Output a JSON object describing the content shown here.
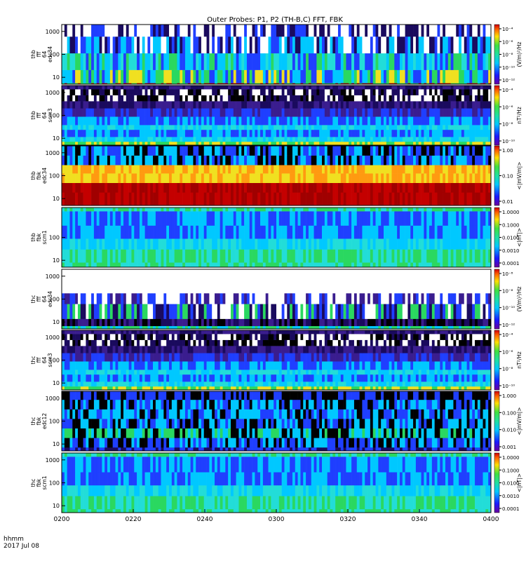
{
  "title": "Outer Probes: P1, P2 (TH-B,C) FFT, FBK",
  "time_axis": {
    "label_line1": "hhmm",
    "label_line2": "2017 Jul 08",
    "ticks": [
      "0200",
      "0220",
      "0240",
      "0300",
      "0320",
      "0340",
      "0400"
    ]
  },
  "colors": {
    "black": "#000000",
    "navy": "#1a0a5e",
    "purple": "#3a1d8f",
    "blue": "#1f3fff",
    "cyan": "#00c8ff",
    "aqua": "#22ddd8",
    "green": "#2ad860",
    "yellow": "#f0e020",
    "orange": "#ff9a10",
    "red": "#c40000",
    "darkred": "#a00000"
  },
  "chart_data": [
    {
      "type": "heatmap",
      "ylabel": [
        "thb",
        "fff",
        "64",
        "edc34"
      ],
      "yticks": [
        "10",
        "100",
        "1000"
      ],
      "colorbar_label": "(V/m)²/Hz",
      "colorbar_ticks": [
        "10⁻⁴",
        "10⁻⁶",
        "10⁻⁸",
        "10⁻¹⁰",
        "10⁻¹²"
      ],
      "bands": [
        {
          "frac": 0.02,
          "palette": [
            "red",
            "green"
          ]
        },
        {
          "frac": 0.22,
          "palette": [
            "cyan",
            "green",
            "yellow",
            "blue"
          ]
        },
        {
          "frac": 0.28,
          "palette": [
            "cyan",
            "blue",
            "green",
            "aqua"
          ]
        },
        {
          "frac": 0.28,
          "palette": [
            "blue",
            "cyan",
            "navy",
            "white"
          ]
        },
        {
          "frac": 0.2,
          "palette": [
            "white",
            "blue",
            "navy",
            "white"
          ]
        }
      ]
    },
    {
      "type": "heatmap",
      "ylabel": [
        "thb",
        "fff",
        "64",
        "scm3"
      ],
      "yticks": [
        "10",
        "100",
        "1000"
      ],
      "colorbar_label": "nT²/Hz",
      "colorbar_ticks": [
        "10⁻⁴",
        "10⁻⁶",
        "10⁻⁸",
        "10⁻¹⁰"
      ],
      "bands": [
        {
          "frac": 0.06,
          "palette": [
            "green",
            "yellow"
          ]
        },
        {
          "frac": 0.08,
          "palette": [
            "aqua",
            "cyan"
          ]
        },
        {
          "frac": 0.12,
          "palette": [
            "cyan",
            "blue"
          ]
        },
        {
          "frac": 0.08,
          "palette": [
            "aqua",
            "cyan"
          ]
        },
        {
          "frac": 0.14,
          "palette": [
            "blue",
            "cyan"
          ]
        },
        {
          "frac": 0.14,
          "palette": [
            "blue",
            "purple"
          ]
        },
        {
          "frac": 0.12,
          "palette": [
            "navy",
            "purple"
          ]
        },
        {
          "frac": 0.1,
          "palette": [
            "navy",
            "black",
            "white"
          ]
        },
        {
          "frac": 0.1,
          "palette": [
            "white",
            "black",
            "navy"
          ]
        },
        {
          "frac": 0.06,
          "palette": [
            "purple",
            "navy"
          ]
        }
      ]
    },
    {
      "type": "heatmap",
      "ylabel": [
        "thb",
        "fbk",
        "edc34"
      ],
      "yticks": [
        "10",
        "100",
        "1000"
      ],
      "colorbar_label": "<|mV/m|>",
      "colorbar_ticks": [
        "1.00",
        "0.10",
        "0.01"
      ],
      "bands": [
        {
          "frac": 0.22,
          "palette": [
            "darkred",
            "red"
          ]
        },
        {
          "frac": 0.16,
          "palette": [
            "red",
            "darkred"
          ]
        },
        {
          "frac": 0.16,
          "palette": [
            "orange",
            "yellow"
          ]
        },
        {
          "frac": 0.14,
          "palette": [
            "yellow",
            "orange"
          ]
        },
        {
          "frac": 0.16,
          "palette": [
            "cyan",
            "blue",
            "black"
          ]
        },
        {
          "frac": 0.16,
          "palette": [
            "black",
            "cyan",
            "blue"
          ]
        }
      ]
    },
    {
      "type": "heatmap",
      "ylabel": [
        "thb",
        "fbk",
        "scm1"
      ],
      "yticks": [
        "10",
        "100"
      ],
      "colorbar_label": "<|nT|>",
      "colorbar_ticks": [
        "1.0000",
        "0.1000",
        "0.0100",
        "0.0010",
        "0.0001"
      ],
      "bands": [
        {
          "frac": 0.08,
          "palette": [
            "green",
            "aqua"
          ]
        },
        {
          "frac": 0.22,
          "palette": [
            "aqua",
            "green"
          ]
        },
        {
          "frac": 0.18,
          "palette": [
            "cyan",
            "aqua"
          ]
        },
        {
          "frac": 0.22,
          "palette": [
            "blue",
            "cyan"
          ]
        },
        {
          "frac": 0.24,
          "palette": [
            "blue",
            "cyan"
          ]
        },
        {
          "frac": 0.06,
          "palette": [
            "green",
            "aqua"
          ]
        }
      ]
    },
    {
      "type": "heatmap",
      "ylabel": [
        "thc",
        "fff",
        "64",
        "edc34"
      ],
      "yticks": [
        "10",
        "100",
        "1000"
      ],
      "colorbar_label": "(V/m)²/Hz",
      "colorbar_ticks": [
        "10⁻⁸",
        "10⁻⁸",
        "10⁻¹⁰",
        "10⁻¹²"
      ],
      "bands": [
        {
          "frac": 0.05,
          "palette": [
            "green",
            "cyan"
          ]
        },
        {
          "frac": 0.12,
          "palette": [
            "navy",
            "purple",
            "black"
          ]
        },
        {
          "frac": 0.25,
          "palette": [
            "blue",
            "navy",
            "white",
            "green"
          ]
        },
        {
          "frac": 0.18,
          "palette": [
            "white",
            "blue",
            "purple",
            "white"
          ]
        },
        {
          "frac": 0.4,
          "palette": [
            "white"
          ]
        }
      ]
    },
    {
      "type": "heatmap",
      "ylabel": [
        "thc",
        "fff",
        "64",
        "scm3"
      ],
      "yticks": [
        "10",
        "100",
        "1000"
      ],
      "colorbar_label": "nT²/Hz",
      "colorbar_ticks": [
        "10⁻⁴",
        "10⁻⁶",
        "10⁻⁸",
        "10⁻¹⁰"
      ],
      "bands": [
        {
          "frac": 0.06,
          "palette": [
            "green",
            "yellow"
          ]
        },
        {
          "frac": 0.08,
          "palette": [
            "aqua",
            "cyan"
          ]
        },
        {
          "frac": 0.12,
          "palette": [
            "cyan",
            "blue"
          ]
        },
        {
          "frac": 0.08,
          "palette": [
            "aqua",
            "cyan"
          ]
        },
        {
          "frac": 0.14,
          "palette": [
            "blue",
            "cyan"
          ]
        },
        {
          "frac": 0.14,
          "palette": [
            "blue",
            "purple"
          ]
        },
        {
          "frac": 0.12,
          "palette": [
            "navy",
            "purple"
          ]
        },
        {
          "frac": 0.1,
          "palette": [
            "navy",
            "black",
            "white"
          ]
        },
        {
          "frac": 0.1,
          "palette": [
            "white",
            "black",
            "navy"
          ]
        },
        {
          "frac": 0.06,
          "palette": [
            "purple",
            "navy"
          ]
        }
      ]
    },
    {
      "type": "heatmap",
      "ylabel": [
        "thc",
        "fbk",
        "edc12"
      ],
      "yticks": [
        "10",
        "100",
        "1000"
      ],
      "colorbar_label": "<|mV/m|>",
      "colorbar_ticks": [
        "1.000",
        "0.100",
        "0.010",
        "0.001"
      ],
      "bands": [
        {
          "frac": 0.06,
          "palette": [
            "blue",
            "navy"
          ]
        },
        {
          "frac": 0.16,
          "palette": [
            "black",
            "blue",
            "cyan"
          ]
        },
        {
          "frac": 0.16,
          "palette": [
            "black",
            "cyan",
            "green"
          ]
        },
        {
          "frac": 0.16,
          "palette": [
            "blue",
            "cyan",
            "black"
          ]
        },
        {
          "frac": 0.16,
          "palette": [
            "black",
            "cyan",
            "blue"
          ]
        },
        {
          "frac": 0.16,
          "palette": [
            "black",
            "blue",
            "cyan"
          ]
        },
        {
          "frac": 0.14,
          "palette": [
            "black",
            "blue"
          ]
        }
      ]
    },
    {
      "type": "heatmap",
      "ylabel": [
        "thc",
        "fbk",
        "scm1"
      ],
      "yticks": [
        "10",
        "100",
        "1000"
      ],
      "colorbar_label": "<|nT|>",
      "colorbar_ticks": [
        "1.0000",
        "0.1000",
        "0.0100",
        "0.0010",
        "0.0001"
      ],
      "bands": [
        {
          "frac": 0.06,
          "palette": [
            "green",
            "aqua"
          ]
        },
        {
          "frac": 0.22,
          "palette": [
            "aqua",
            "green"
          ]
        },
        {
          "frac": 0.18,
          "palette": [
            "cyan",
            "aqua"
          ]
        },
        {
          "frac": 0.22,
          "palette": [
            "blue",
            "cyan"
          ]
        },
        {
          "frac": 0.26,
          "palette": [
            "blue",
            "cyan"
          ]
        },
        {
          "frac": 0.06,
          "palette": [
            "aqua",
            "green"
          ]
        }
      ]
    }
  ]
}
